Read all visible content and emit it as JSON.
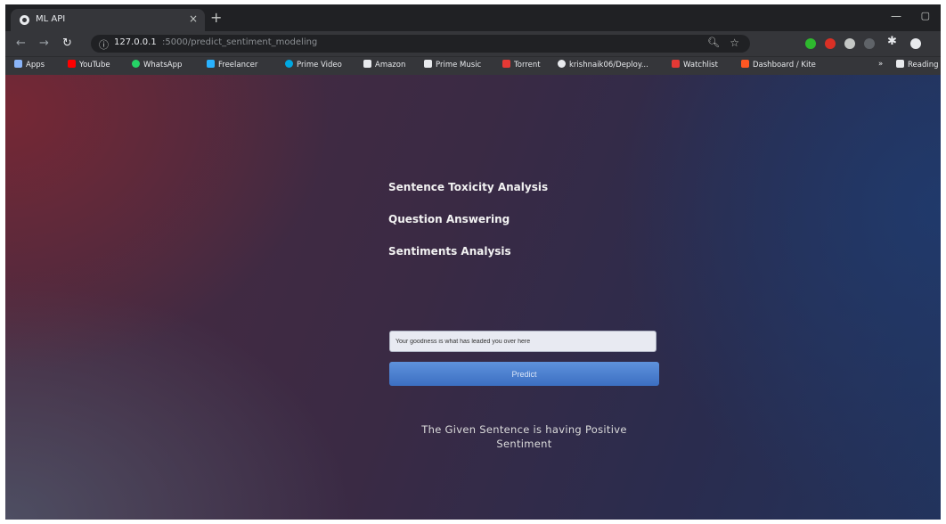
{
  "browser": {
    "tab_title": "ML API",
    "tab_close": "×",
    "new_tab": "+",
    "window_min": "—",
    "window_max": "▢",
    "url_host": "127.0.0.1",
    "url_path": ":5000/predict_sentiment_modeling",
    "icons": [
      "back-arrow",
      "forward-arrow",
      "reload",
      "info",
      "zoom",
      "star",
      "extension-puzzle",
      "profile"
    ]
  },
  "bookmarks": [
    {
      "label": "Apps",
      "color": "#8ab4f8"
    },
    {
      "label": "YouTube",
      "color": "#ff0000"
    },
    {
      "label": "WhatsApp",
      "color": "#25d366"
    },
    {
      "label": "Freelancer",
      "color": "#29b2fe"
    },
    {
      "label": "Prime Video",
      "color": "#00a8e1"
    },
    {
      "label": "Amazon",
      "color": "#e8eaed"
    },
    {
      "label": "Prime Music",
      "color": "#e8eaed"
    },
    {
      "label": "Torrent",
      "color": "#e53935"
    },
    {
      "label": "krishnaik06/Deploy...",
      "color": "#e8eaed"
    },
    {
      "label": "Watchlist",
      "color": "#e53935"
    },
    {
      "label": "Dashboard / Kite",
      "color": "#ff5722"
    },
    {
      "label": "»",
      "color": ""
    },
    {
      "label": "Reading list",
      "color": "#e8eaed"
    }
  ],
  "page": {
    "menu": [
      "Sentence Toxicity Analysis",
      "Question Answering",
      "Sentiments Analysis"
    ],
    "input_value": "Your goodness is what has leaded you over here",
    "predict_label": "Predict",
    "result_line1": "The Given Sentence is having Positive",
    "result_line2": "Sentiment"
  }
}
